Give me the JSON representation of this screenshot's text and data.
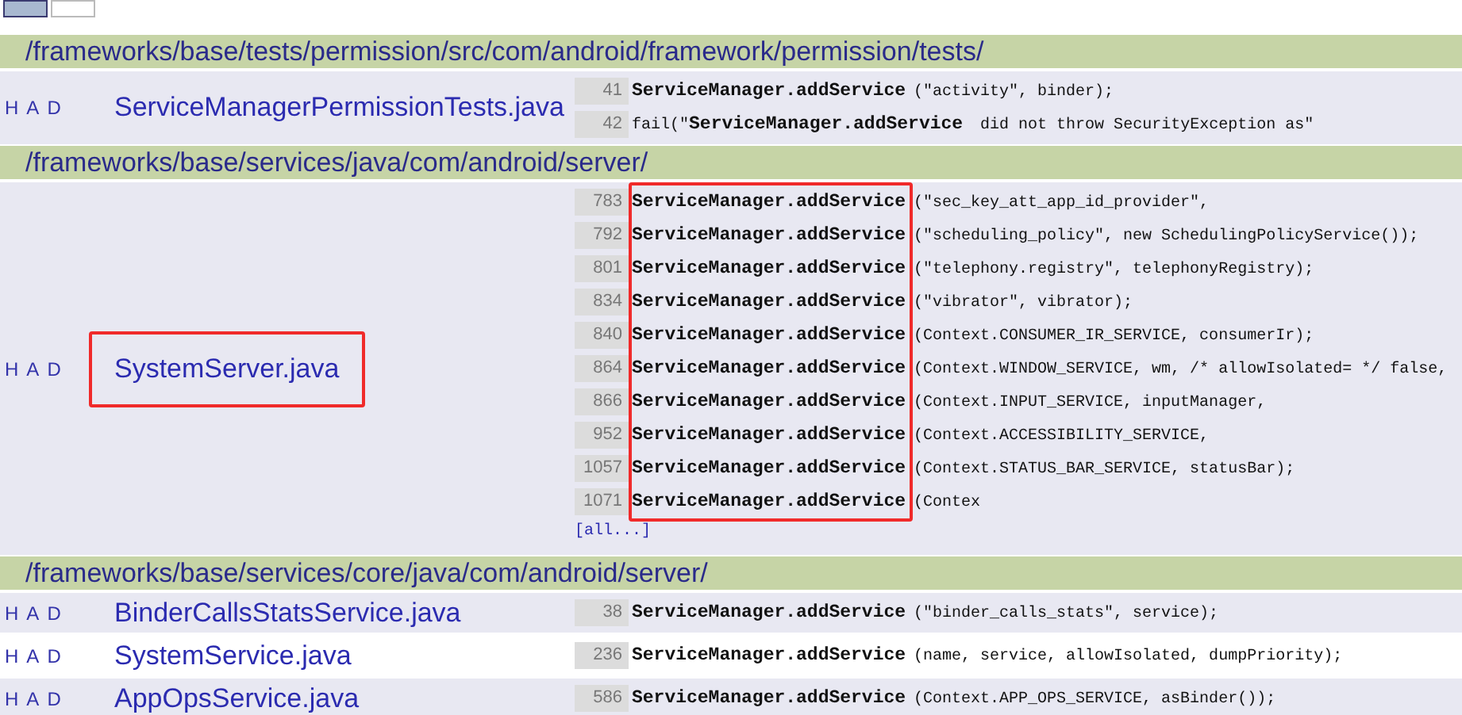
{
  "toolbar": {
    "swatches": [
      {
        "color": "#a8b8d0",
        "selected": true
      },
      {
        "color": "#ffffff",
        "selected": false
      }
    ]
  },
  "groups": [
    {
      "path": "/frameworks/base/tests/permission/src/com/android/framework/permission/tests/",
      "files": [
        {
          "links": [
            "H",
            "A",
            "D"
          ],
          "name": "ServiceManagerPermissionTests.java",
          "highlighted": false,
          "code_highlighted": false,
          "lines": [
            {
              "number": "41",
              "code": "**ServiceManager.addService**(\"activity\", binder);"
            },
            {
              "number": "42",
              "code": "fail(\"**ServiceManager.addService** did not throw SecurityException as\""
            }
          ]
        }
      ]
    },
    {
      "path": "/frameworks/base/services/java/com/android/server/",
      "files": [
        {
          "links": [
            "H",
            "A",
            "D"
          ],
          "name": "SystemServer.java",
          "highlighted": true,
          "code_highlighted": true,
          "more": "[all...]",
          "lines": [
            {
              "number": "783",
              "code": "**ServiceManager.addService**(\"sec_key_att_app_id_provider\","
            },
            {
              "number": "792",
              "code": "**ServiceManager.addService**(\"scheduling_policy\", new SchedulingPolicyService());"
            },
            {
              "number": "801",
              "code": "**ServiceManager.addService**(\"telephony.registry\", telephonyRegistry);"
            },
            {
              "number": "834",
              "code": "**ServiceManager.addService**(\"vibrator\", vibrator);"
            },
            {
              "number": "840",
              "code": "**ServiceManager.addService**(Context.CONSUMER_IR_SERVICE, consumerIr);"
            },
            {
              "number": "864",
              "code": "**ServiceManager.addService**(Context.WINDOW_SERVICE, wm, /* allowIsolated= */ false,"
            },
            {
              "number": "866",
              "code": "**ServiceManager.addService**(Context.INPUT_SERVICE, inputManager,"
            },
            {
              "number": "952",
              "code": "**ServiceManager.addService**(Context.ACCESSIBILITY_SERVICE,"
            },
            {
              "number": "1057",
              "code": "**ServiceManager.addService**(Context.STATUS_BAR_SERVICE, statusBar);"
            },
            {
              "number": "1071",
              "code": "**ServiceManager.addService**(Contex"
            }
          ]
        }
      ]
    },
    {
      "path": "/frameworks/base/services/core/java/com/android/server/",
      "files": [
        {
          "links": [
            "H",
            "A",
            "D"
          ],
          "name": "BinderCallsStatsService.java",
          "highlighted": false,
          "code_highlighted": false,
          "lines": [
            {
              "number": "38",
              "code": "**ServiceManager.addService**(\"binder_calls_stats\", service);"
            }
          ]
        },
        {
          "links": [
            "H",
            "A",
            "D"
          ],
          "name": "SystemService.java",
          "highlighted": false,
          "code_highlighted": false,
          "lines": [
            {
              "number": "236",
              "code": "**ServiceManager.addService**(name, service, allowIsolated, dumpPriority);"
            }
          ]
        },
        {
          "links": [
            "H",
            "A",
            "D"
          ],
          "name": "AppOpsService.java",
          "highlighted": false,
          "code_highlighted": false,
          "lines": [
            {
              "number": "586",
              "code": "**ServiceManager.addService**(Context.APP_OPS_SERVICE, asBinder());"
            }
          ]
        }
      ]
    }
  ]
}
